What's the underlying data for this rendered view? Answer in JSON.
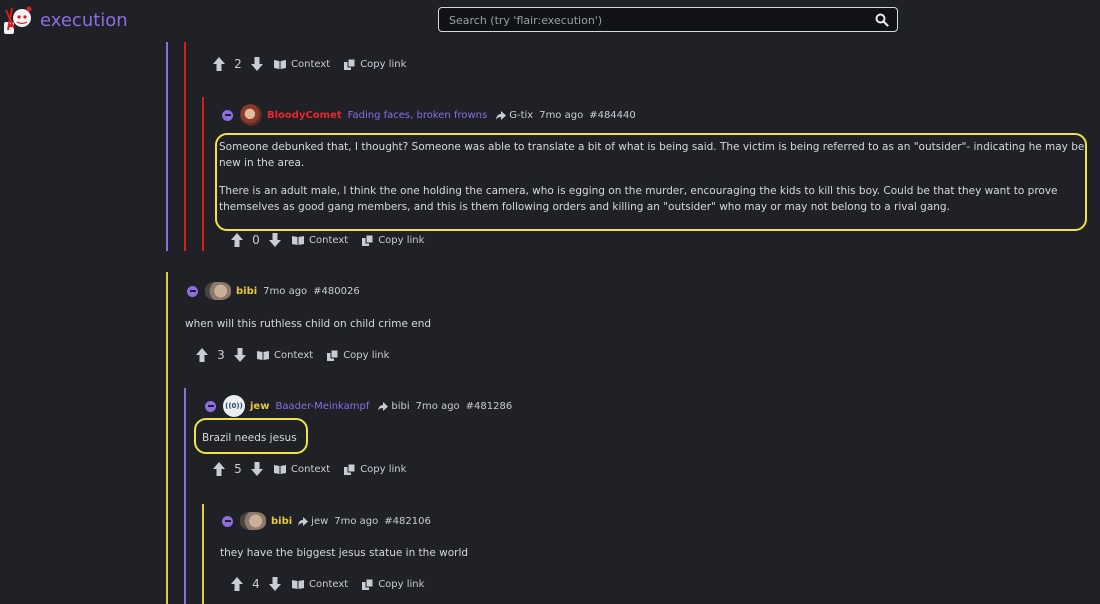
{
  "header": {
    "site_name": "execution",
    "search_placeholder": "Search (try 'flair:execution')"
  },
  "actions": {
    "context_label": "Context",
    "copy_link_label": "Copy link"
  },
  "comments": [
    {
      "score": "2"
    },
    {
      "username": "BloodyComet",
      "flair": "Fading faces, broken frowns",
      "reply_to": "G-tix",
      "time": "7mo ago",
      "id": "#484440",
      "paragraphs": [
        "Someone debunked that, I thought? Someone was able to translate a bit of what is being said. The victim is being referred to as an \"outsider\"- indicating he may be new in the area.",
        "There is an adult male, I think the one holding the camera, who is egging on the murder, encouraging the kids to kill this boy. Could be that they want to prove themselves as good gang members, and this is them following orders and killing an \"outsider\" who may or may not belong to a rival gang."
      ],
      "score": "0"
    },
    {
      "username": "bibi",
      "time": "7mo ago",
      "id": "#480026",
      "text": "when will this ruthless child on child crime end",
      "score": "3"
    },
    {
      "username": "jew",
      "avatar_text": "((0))",
      "flair": "Baader-Meinkampf",
      "reply_to": "bibi",
      "time": "7mo ago",
      "id": "#481286",
      "text": "Brazil needs jesus",
      "score": "5"
    },
    {
      "username": "bibi",
      "reply_to": "jew",
      "time": "7mo ago",
      "id": "#482106",
      "text": "they have the biggest jesus statue in the world",
      "score": "4"
    }
  ],
  "colors": {
    "background": "#1f2126",
    "accent_purple": "#8c6ee0",
    "username_red": "#e8262d",
    "username_yellow": "#e7c93c",
    "highlight_yellow": "#f0e445",
    "thread_red": "#d81d1d"
  }
}
